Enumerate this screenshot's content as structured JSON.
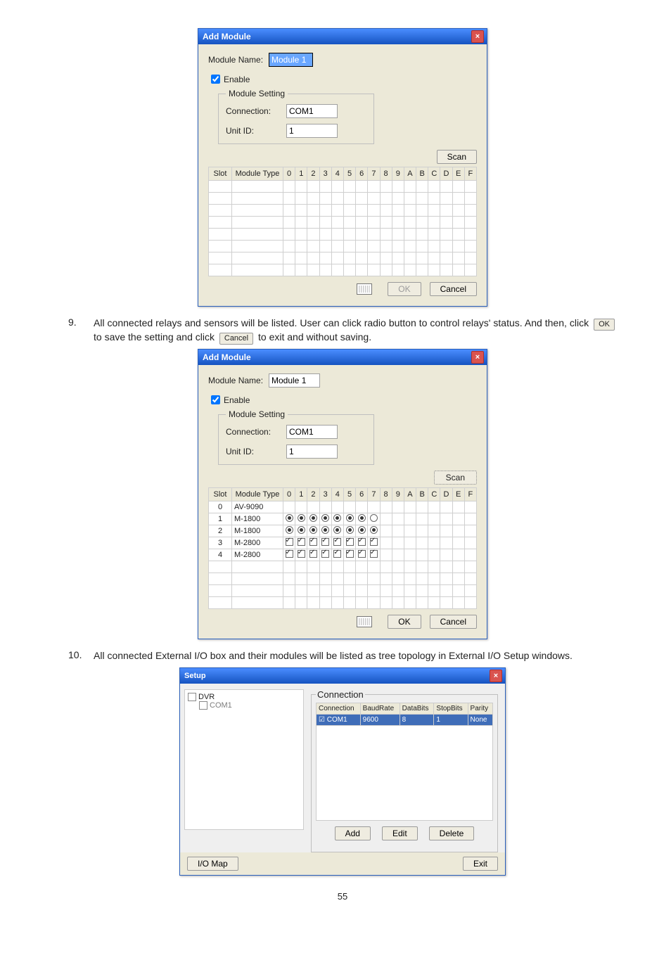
{
  "page_number": "55",
  "dialog1": {
    "title": "Add Module",
    "module_name_label": "Module Name:",
    "module_name_value": "Module 1",
    "enable_label": "Enable",
    "enable_checked": true,
    "setting_legend": "Module Setting",
    "connection_label": "Connection:",
    "connection_value": "COM1",
    "unitid_label": "Unit ID:",
    "unitid_value": "1",
    "scan_btn": "Scan",
    "ok_btn": "OK",
    "cancel_btn": "Cancel",
    "headers": [
      "Slot",
      "Module Type",
      "0",
      "1",
      "2",
      "3",
      "4",
      "5",
      "6",
      "7",
      "8",
      "9",
      "A",
      "B",
      "C",
      "D",
      "E",
      "F"
    ]
  },
  "step9": {
    "num": "9.",
    "text_a": "All connected relays and sensors will be listed. User can click radio button to control relays' status. And then, click ",
    "btn_ok": "OK",
    "text_b": " to save the setting and click ",
    "btn_cancel": "Cancel",
    "text_c": " to exit and without saving."
  },
  "dialog2": {
    "title": "Add Module",
    "module_name_label": "Module Name:",
    "module_name_value": "Module 1",
    "enable_label": "Enable",
    "enable_checked": true,
    "setting_legend": "Module Setting",
    "connection_label": "Connection:",
    "connection_value": "COM1",
    "unitid_label": "Unit ID:",
    "unitid_value": "1",
    "scan_btn": "Scan",
    "ok_btn": "OK",
    "cancel_btn": "Cancel",
    "headers": [
      "Slot",
      "Module Type",
      "0",
      "1",
      "2",
      "3",
      "4",
      "5",
      "6",
      "7",
      "8",
      "9",
      "A",
      "B",
      "C",
      "D",
      "E",
      "F"
    ],
    "rows": [
      {
        "slot": "0",
        "type": "AV-9090",
        "ctrl": "none"
      },
      {
        "slot": "1",
        "type": "M-1800",
        "ctrl": "radio",
        "state": [
          "on",
          "on",
          "on",
          "on",
          "on",
          "on",
          "on",
          "off"
        ]
      },
      {
        "slot": "2",
        "type": "M-1800",
        "ctrl": "radio",
        "state": [
          "on",
          "on",
          "on",
          "on",
          "on",
          "on",
          "on",
          "on"
        ]
      },
      {
        "slot": "3",
        "type": "M-2800",
        "ctrl": "check",
        "state": [
          "on",
          "on",
          "on",
          "on",
          "on",
          "on",
          "on",
          "on"
        ]
      },
      {
        "slot": "4",
        "type": "M-2800",
        "ctrl": "check",
        "state": [
          "on",
          "on",
          "on",
          "on",
          "on",
          "on",
          "on",
          "on"
        ]
      }
    ]
  },
  "step10": {
    "num": "10.",
    "text": "All connected External I/O box and their modules will be listed as tree topology in External I/O Setup windows."
  },
  "setup": {
    "title": "Setup",
    "root": "DVR",
    "com": "COM1",
    "conn_legend": "Connection",
    "th": [
      "Connection",
      "BaudRate",
      "DataBits",
      "StopBits",
      "Parity"
    ],
    "td": [
      "COM1",
      "9600",
      "8",
      "1",
      "None"
    ],
    "add_btn": "Add",
    "edit_btn": "Edit",
    "delete_btn": "Delete",
    "iomap_btn": "I/O Map",
    "exit_btn": "Exit"
  }
}
